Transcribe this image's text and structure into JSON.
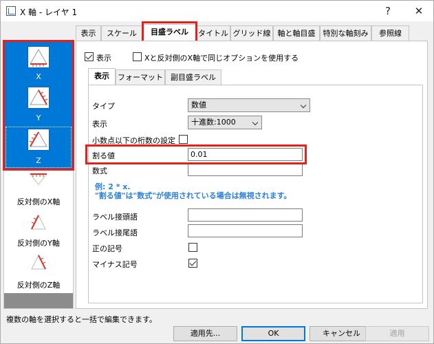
{
  "window": {
    "title": "X 軸 - レイヤ 1",
    "help_glyph": "?",
    "close_glyph": "✕"
  },
  "sidebar": {
    "items": [
      {
        "label": "X",
        "icon": "x-axis-icon",
        "selected": true
      },
      {
        "label": "Y",
        "icon": "y-axis-icon",
        "selected": true
      },
      {
        "label": "Z",
        "icon": "z-axis-icon",
        "selected": true
      },
      {
        "label": "反対側のX軸",
        "icon": "opposite-x-axis-icon",
        "selected": false
      },
      {
        "label": "反対側のY軸",
        "icon": "opposite-y-axis-icon",
        "selected": false
      },
      {
        "label": "反対側のZ軸",
        "icon": "opposite-z-axis-icon",
        "selected": false
      }
    ]
  },
  "tabs": [
    "表示",
    "スケール",
    "目盛ラベル",
    "タイトル",
    "グリッド線",
    "軸と軸目盛",
    "特別な軸刻み",
    "参照線"
  ],
  "active_tab": "目盛ラベル",
  "options": {
    "show_label": "表示",
    "show_checked": true,
    "same_options_label": "Xと反対側のX軸で同じオプションを使用する",
    "same_options_checked": false
  },
  "subtabs": [
    "表示",
    "フォーマット",
    "副目盛ラベル"
  ],
  "form": {
    "type_label": "タイプ",
    "type_value": "数値",
    "display_label": "表示",
    "display_value": "十進数:1000",
    "decimals_label": "小数点以下の桁数の設定",
    "decimals_checked": false,
    "divide_label": "割る値",
    "divide_value": "0.01",
    "formula_label": "数式",
    "formula_value": "",
    "hint_line1": "例: 2 * x.",
    "hint_line2": "\"割る値\"は\"数式\"が使用されている場合は無視されます。",
    "prefix_label": "ラベル接頭語",
    "prefix_value": "",
    "suffix_label": "ラベル接尾語",
    "suffix_value": "",
    "plus_label": "正の記号",
    "plus_checked": false,
    "minus_label": "マイナス記号",
    "minus_checked": true
  },
  "status_text": "複数の軸を選択すると一括で編集できます。",
  "buttons": {
    "apply_to": "適用先...",
    "ok": "OK",
    "cancel": "キャンセル",
    "apply": "適用"
  },
  "colors": {
    "selection": "#0078d7",
    "highlight": "#e8201a",
    "hint": "#2a7fd9"
  }
}
